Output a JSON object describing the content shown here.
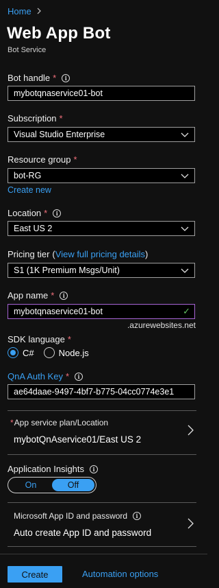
{
  "breadcrumb": {
    "home": "Home"
  },
  "header": {
    "title": "Web App Bot",
    "subtitle": "Bot Service"
  },
  "fields": {
    "bot_handle": {
      "label": "Bot handle",
      "required": "*",
      "value": "mybotqnaservice01-bot"
    },
    "subscription": {
      "label": "Subscription",
      "required": "*",
      "value": "Visual Studio Enterprise"
    },
    "resource_group": {
      "label": "Resource group",
      "required": "*",
      "value": "bot-RG",
      "create_new": "Create new"
    },
    "location": {
      "label": "Location",
      "required": "*",
      "value": "East US 2"
    },
    "pricing_tier": {
      "label": "Pricing tier",
      "paren_open": "(",
      "link": "View full pricing details",
      "paren_close": ")",
      "value": "S1 (1K Premium Msgs/Unit)"
    },
    "app_name": {
      "label": "App name",
      "required": "*",
      "value": "mybotqnaservice01-bot",
      "suffix": ".azurewebsites.net"
    },
    "sdk_language": {
      "label": "SDK language",
      "required": "*",
      "options": [
        "C#",
        "Node.js"
      ],
      "selected": "C#"
    },
    "qna_auth_key": {
      "label": "QnA Auth Key",
      "required": "*",
      "value": "ae64daae-9497-4bf7-b775-04cc0774e3e1"
    }
  },
  "app_service_plan": {
    "required": "*",
    "label": "App service plan/Location",
    "value": "mybotQnAservice01/East US 2"
  },
  "app_insights": {
    "label": "Application Insights",
    "options": [
      "On",
      "Off"
    ],
    "selected": "Off"
  },
  "microsoft_app": {
    "label": "Microsoft App ID and password",
    "value": "Auto create App ID and password"
  },
  "footer": {
    "create": "Create",
    "automation": "Automation options"
  },
  "icons": {
    "info": "i",
    "check": "✓"
  },
  "colors": {
    "accent": "#3aa0f3",
    "required": "#f1707b",
    "valid": "#60c060",
    "background": "#111111"
  }
}
